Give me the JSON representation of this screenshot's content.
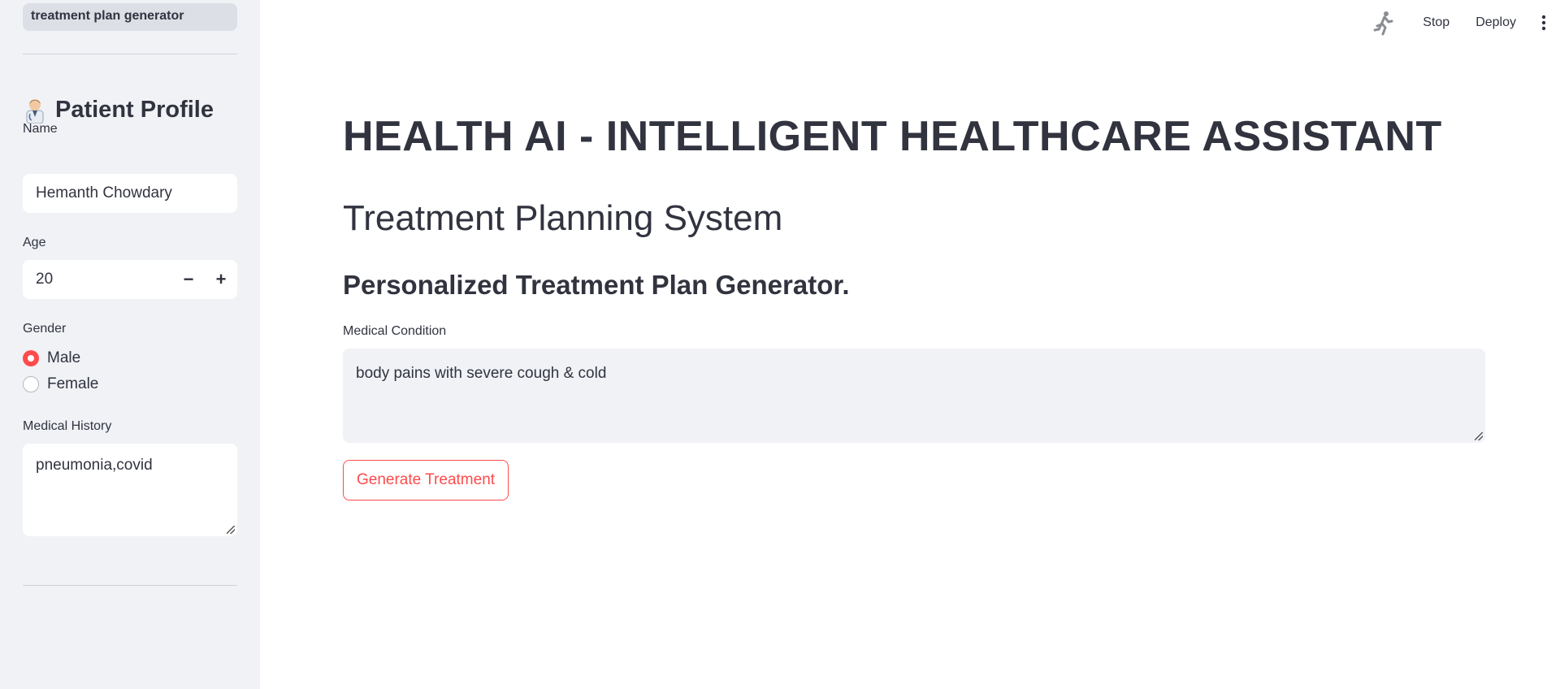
{
  "sidebar": {
    "nav_item": "treatment plan generator",
    "profile_title": "Patient Profile",
    "name": {
      "label": "Name",
      "value": "Hemanth Chowdary"
    },
    "age": {
      "label": "Age",
      "value": "20",
      "decrement": "−",
      "increment": "+"
    },
    "gender": {
      "label": "Gender",
      "options": [
        {
          "label": "Male",
          "selected": true
        },
        {
          "label": "Female",
          "selected": false
        }
      ]
    },
    "medical_history": {
      "label": "Medical History",
      "value": "pneumonia,covid"
    }
  },
  "toolbar": {
    "stop_label": "Stop",
    "deploy_label": "Deploy"
  },
  "main": {
    "title": "HEALTH AI - INTELLIGENT HEALTHCARE ASSISTANT",
    "subtitle": "Treatment Planning System",
    "section_title": "Personalized Treatment Plan Generator.",
    "condition": {
      "label": "Medical Condition",
      "value": "body pains with severe cough & cold"
    },
    "generate_label": "Generate Treatment"
  },
  "colors": {
    "accent": "#ff4b4b",
    "sidebar_bg": "#f0f2f6",
    "text": "#31333f"
  },
  "icons": [
    "doctor-icon",
    "running-man-icon",
    "vertical-dots-icon"
  ]
}
